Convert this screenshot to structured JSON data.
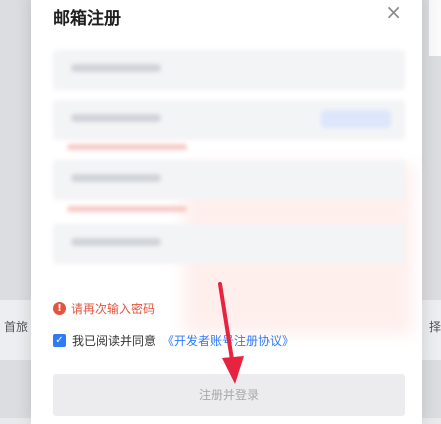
{
  "modal": {
    "title": "邮箱注册",
    "close_symbol": "×",
    "error_message": "请再次输入密码",
    "agreement_prefix": "我已阅读并同意",
    "agreement_link": "《开发者账号注册协议》",
    "submit_label": "注册并登录"
  },
  "background": {
    "left_text": "首旅",
    "right_text": "择"
  },
  "colors": {
    "accent": "#2f7bf6",
    "error": "#e2553f",
    "annotation_arrow": "#e8233f"
  }
}
